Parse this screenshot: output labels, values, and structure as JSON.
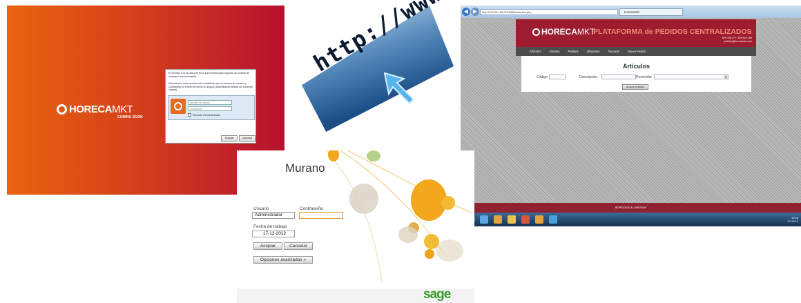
{
  "panel_horeca_login": {
    "logo_text": "HORECA",
    "logo_suffix": "MKT",
    "coming_soon": "COMING SOON",
    "dialog": {
      "message1": "El servidor 213.98.165.232 en la zona Restringido requiere un nombre de usuario y una contraseña.",
      "message2": "Advertencia: este servidor está solicitando que su nombre de usuario y contraseña se envíen de forma no segura (autenticación básica sin conexión segura).",
      "username_placeholder": "Nombre de usuario",
      "password_placeholder": "Contraseña",
      "remember_label": "Recordar mis credenciales",
      "accept_button": "Aceptar",
      "cancel_button": "Cancelar"
    }
  },
  "panel_http": {
    "url_text": "http://www."
  },
  "panel_browser": {
    "address": "http://213.98.165.232:8080/articulos.php",
    "tab_title": "Horecamkt",
    "header_logo": "HORECA",
    "header_logo_suffix": "MKT",
    "header_title": "PLATAFORMA de PEDIDOS CENTRALIZADOS",
    "header_phone": "609 736 377 / 626 624 380",
    "header_email": "pedidos@horecamkt.com",
    "menu": [
      "Artículos",
      "Clientes",
      "Pedidos",
      "Albaranes",
      "Facturas",
      "Nuevo Pedido"
    ],
    "content_title": "Artículos",
    "field_code_label": "Código",
    "field_desc_label": "Descripción",
    "field_provider_label": "Proveedor",
    "search_button": "Buscar Artículo",
    "footer_text": "REPRODUCE AL SERVIDOR",
    "clock_time": "15:46",
    "clock_date": "17/12/12"
  },
  "panel_murano": {
    "app_title": "Murano",
    "user_label": "Usuario",
    "user_value": "Administrador",
    "password_label": "Contraseña",
    "date_label": "Fecha de trabajo",
    "date_value": "17-12-2012",
    "accept_button": "Aceptar",
    "cancel_button": "Cancelar",
    "advanced_button": "Opciones avanzadas »",
    "brand": "sage"
  },
  "colors": {
    "horeca_orange": "#e8650f",
    "horeca_red": "#b51230",
    "header_red": "#9e1c2f",
    "sage_green": "#3a9b2e"
  }
}
